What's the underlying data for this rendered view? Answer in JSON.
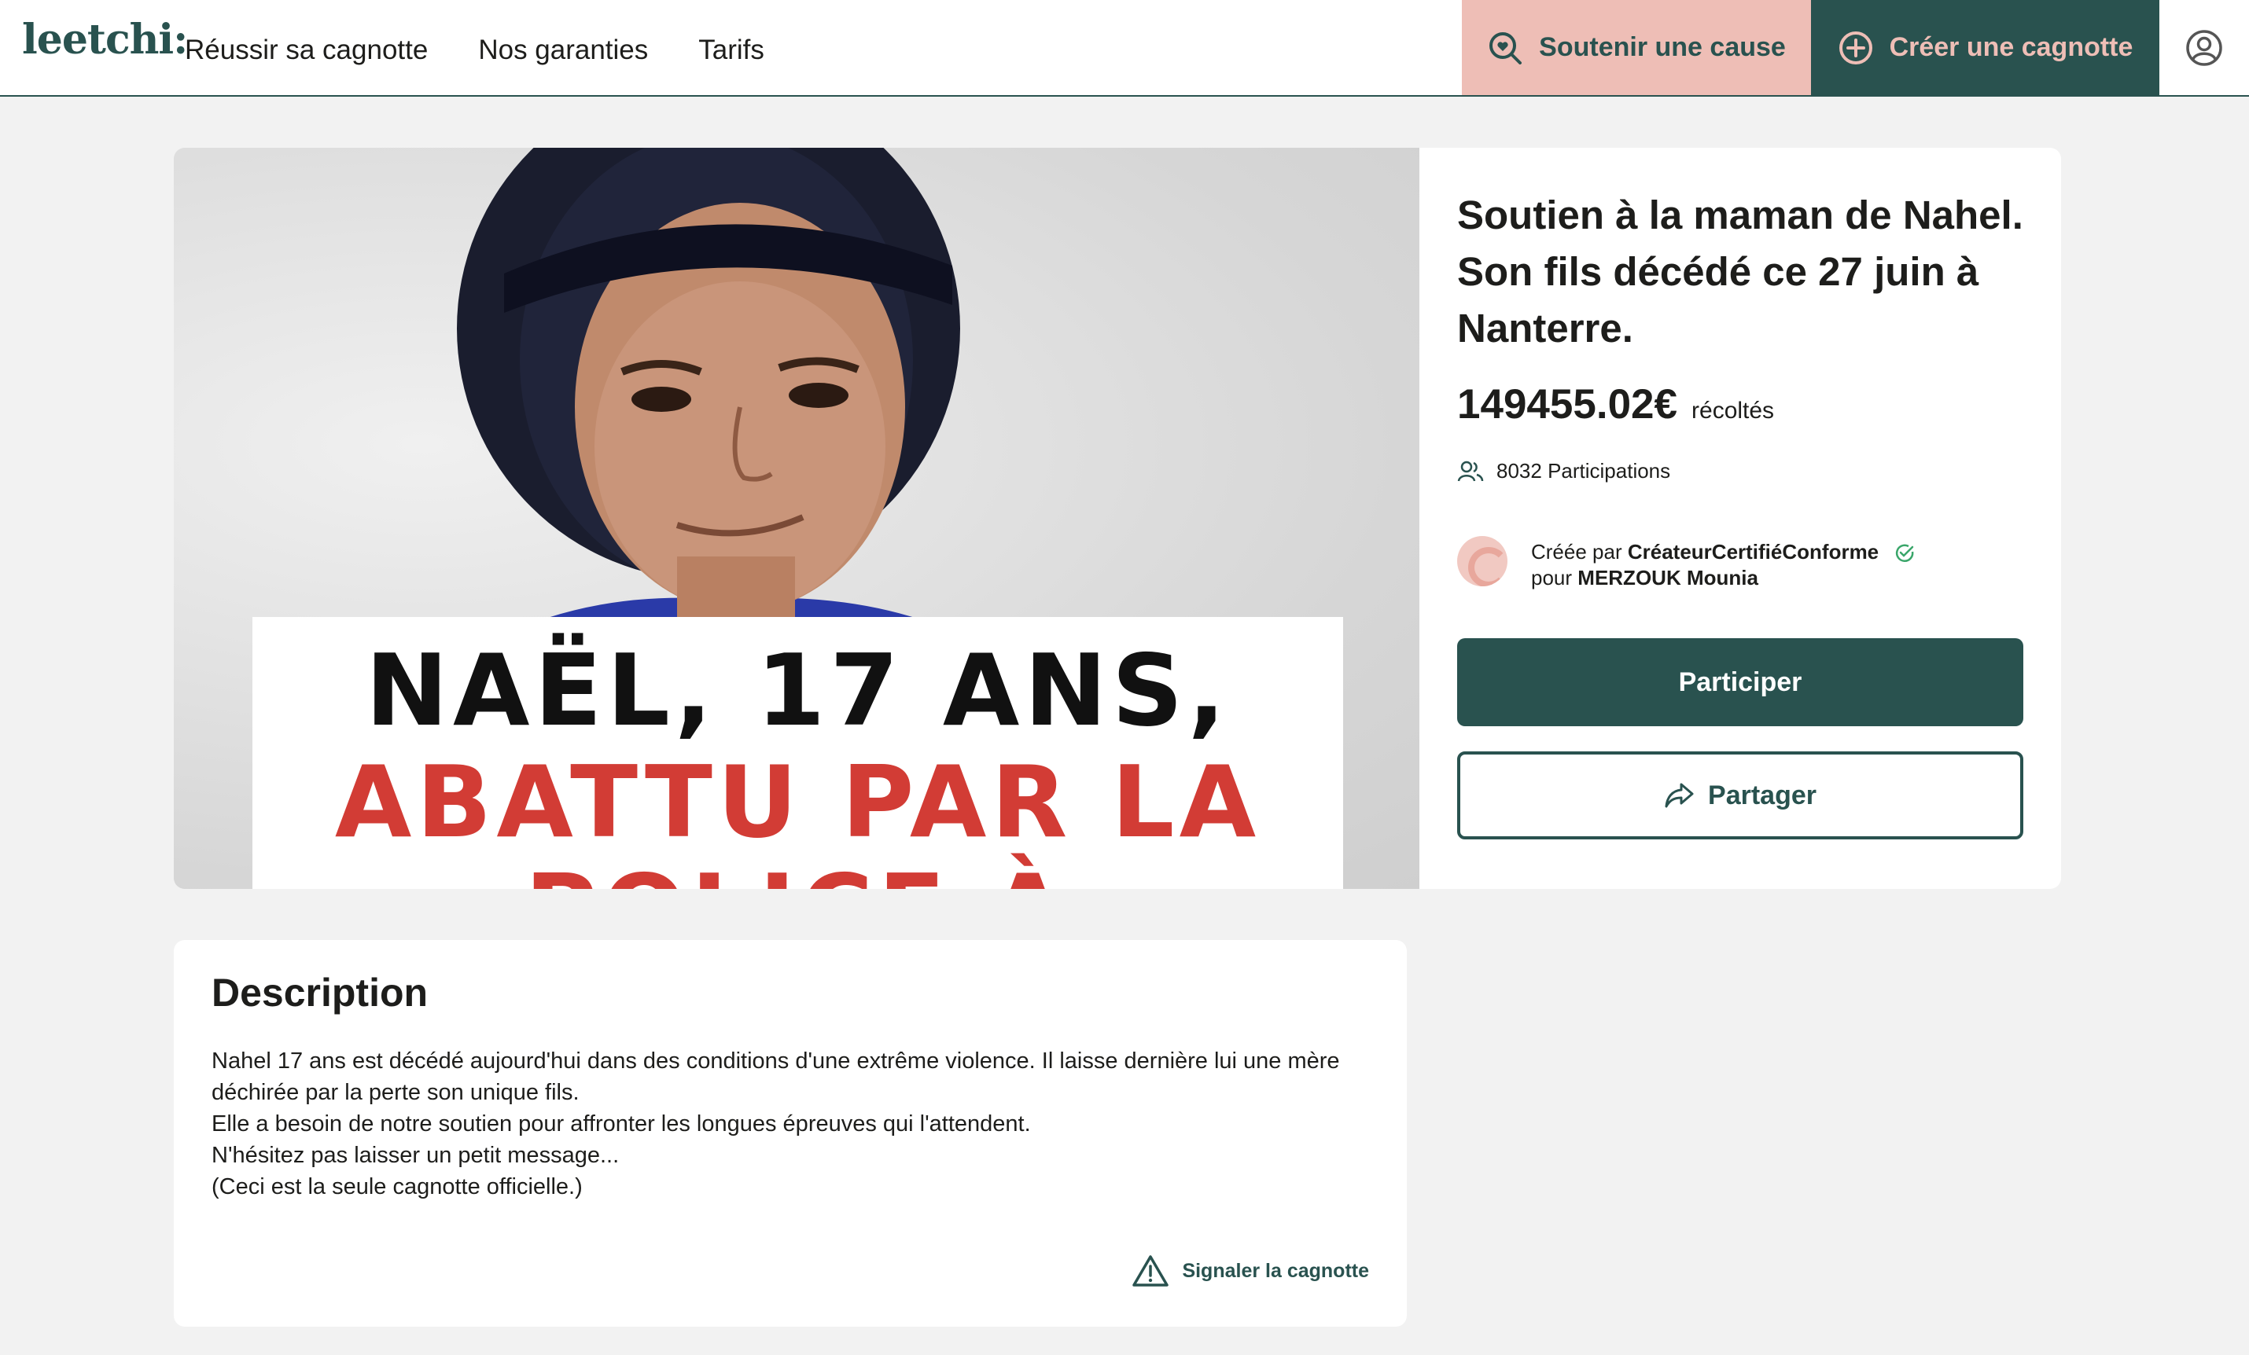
{
  "header": {
    "logo": "leetchi:",
    "nav": [
      {
        "label": "Réussir sa cagnotte"
      },
      {
        "label": "Nos garanties"
      },
      {
        "label": "Tarifs"
      }
    ],
    "support_label": "Soutenir une cause",
    "create_label": "Créer une cagnotte",
    "user_icon": "user-circle-icon"
  },
  "hero": {
    "image_caption_line1": "NAËL, 17 ANS,",
    "image_caption_line2": "ABATTU PAR LA",
    "image_caption_line3": "POLICE À NANTERRE"
  },
  "campaign": {
    "title": "Soutien à la maman de Nahel. Son fils décédé ce 27 juin à Nanterre.",
    "amount": "149455.02€",
    "amount_suffix": "récoltés",
    "participations": "8032 Participations",
    "created_by_prefix": "Créée par",
    "creator_name": "CréateurCertifiéConforme",
    "for_prefix": "pour",
    "beneficiary": "MERZOUK Mounia",
    "participate_label": "Participer",
    "share_label": "Partager"
  },
  "description": {
    "title": "Description",
    "paragraphs": [
      "Nahel 17 ans est décédé aujourd'hui dans des conditions d'une extrême violence. Il laisse dernière lui une mère déchirée par la perte son unique fils.",
      "Elle a besoin de notre soutien pour affronter les longues épreuves qui l'attendent.",
      "N'hésitez pas laisser un petit message...",
      "(Ceci est la seule cagnotte officielle.)"
    ],
    "report_label": "Signaler la cagnotte"
  },
  "colors": {
    "brand_green": "#29524f",
    "brand_pink": "#eebeb6",
    "caption_red": "#d23c35",
    "page_bg": "#f2f2f2"
  }
}
